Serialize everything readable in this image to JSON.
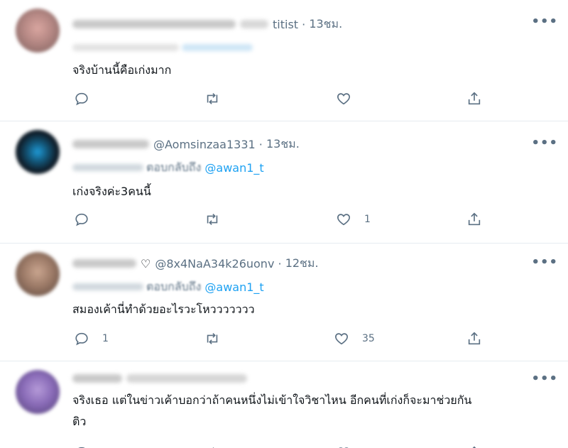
{
  "tweets": [
    {
      "handle": "titist",
      "time": "13ชม.",
      "reply_to": "",
      "text": "จริงบ้านนี้คือเก่งมาก",
      "reply_count": "",
      "retweet_count": "",
      "like_count": ""
    },
    {
      "handle": "@Aomsinzaa1331",
      "time": "13ชม.",
      "reply_to_prefix": "ตอบกลับถึง",
      "reply_to": "@awan1_t",
      "text": "เก่งจริงค่ะ3คนนี้",
      "reply_count": "",
      "retweet_count": "",
      "like_count": "1"
    },
    {
      "name_suffix": "♡",
      "handle": "@8x4NaA34k26uonv",
      "time": "12ชม.",
      "reply_to_prefix": "ตอบกลับถึง",
      "reply_to": "@awan1_t",
      "text": "สมองเค้านี่ทำด้วยอะไรวะโหววววววว",
      "reply_count": "1",
      "retweet_count": "",
      "like_count": "35"
    },
    {
      "handle": "",
      "time": "",
      "reply_to": "",
      "text_line1": "จริงเธอ แต่ในข่าวเค้าบอกว่าถ้าคนหนึ่งไม่เข้าใจวิชาไหน อีกคนที่เก่งก็จะมาช่วยกัน",
      "text_line2": "ติว",
      "reply_count": "",
      "retweet_count": "",
      "like_count": ""
    }
  ],
  "more_label": "•••",
  "icons": {
    "reply": "reply-icon",
    "retweet": "retweet-icon",
    "like": "heart-icon",
    "share": "share-icon"
  },
  "colors": {
    "muted": "#5b7083",
    "link": "#1da1f2",
    "divider": "#e6ecf0"
  }
}
